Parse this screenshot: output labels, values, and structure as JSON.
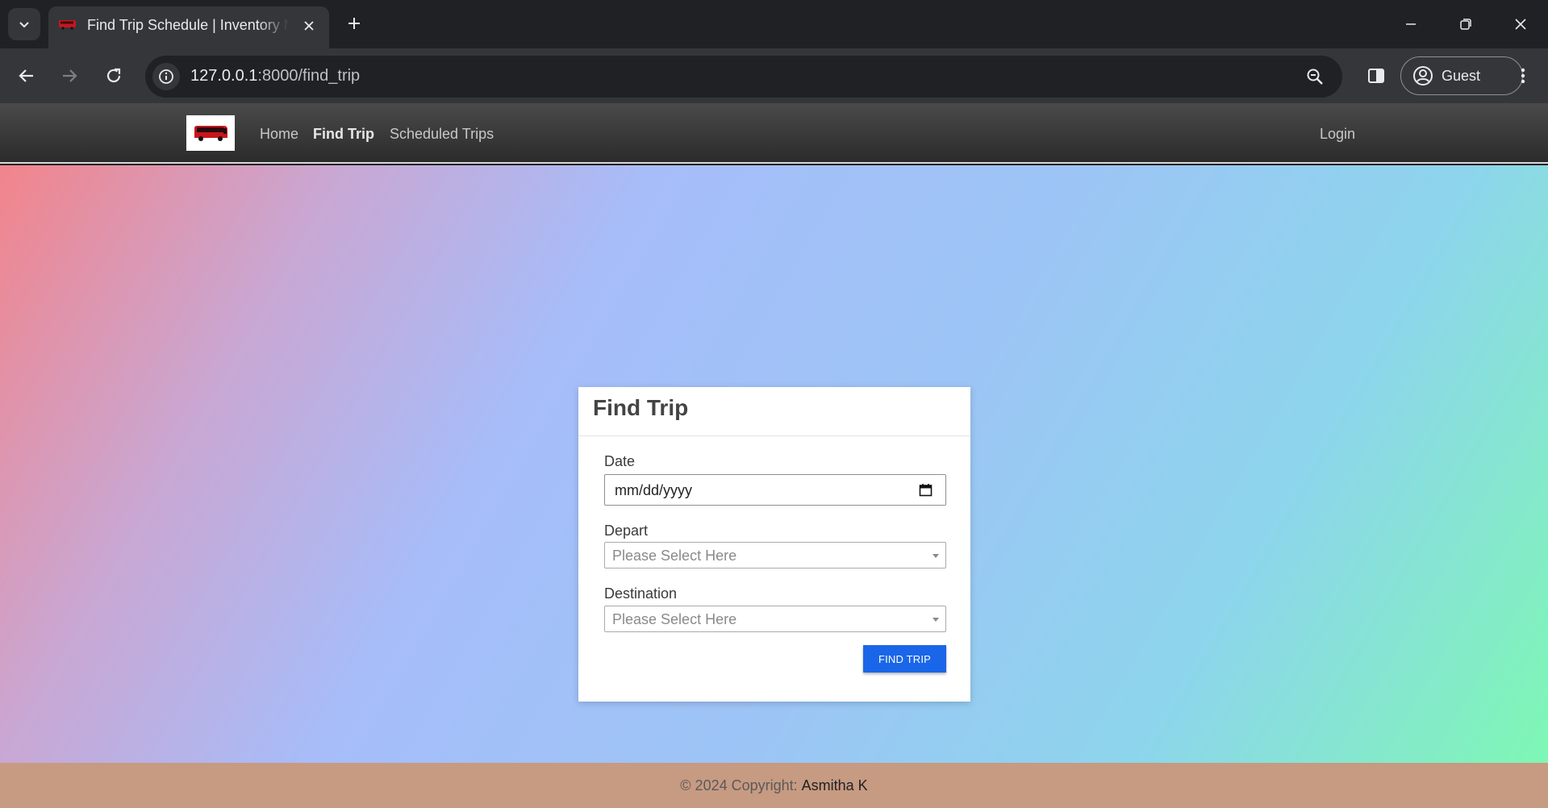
{
  "browser": {
    "tab_title": "Find Trip Schedule | Inventory Management",
    "url_host": "127.0.0.1",
    "url_path": ":8000/find_trip",
    "profile_label": "Guest"
  },
  "site": {
    "nav": {
      "home": "Home",
      "find_trip": "Find Trip",
      "scheduled_trips": "Scheduled Trips",
      "login": "Login"
    }
  },
  "form": {
    "title": "Find Trip",
    "date_label": "Date",
    "date_placeholder": "mm/dd/yyyy",
    "depart_label": "Depart",
    "depart_value": "Please Select Here",
    "destination_label": "Destination",
    "destination_value": "Please Select Here",
    "submit_label": "FIND TRIP"
  },
  "footer": {
    "copyright": "© 2024 Copyright:",
    "author": "Asmitha K"
  },
  "colors": {
    "nav_bg": "#2b2b2b",
    "button": "#1a66e8",
    "footer_bg": "#c79a82"
  }
}
